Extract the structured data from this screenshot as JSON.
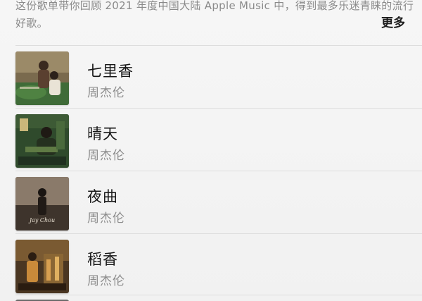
{
  "description": {
    "line1": "这份歌单带你回顾 2021 年度中国大陆 Apple Music 中，得到最多乐迷青睐的流行",
    "line2": "好歌。"
  },
  "more_label": "更多",
  "songs": [
    {
      "title": "七里香",
      "artist": "周杰伦"
    },
    {
      "title": "晴天",
      "artist": "周杰伦"
    },
    {
      "title": "夜曲",
      "artist": "周杰伦"
    },
    {
      "title": "稻香",
      "artist": "周杰伦"
    }
  ],
  "artwork_text": {
    "song3_cover_script": "Jay Chou"
  }
}
